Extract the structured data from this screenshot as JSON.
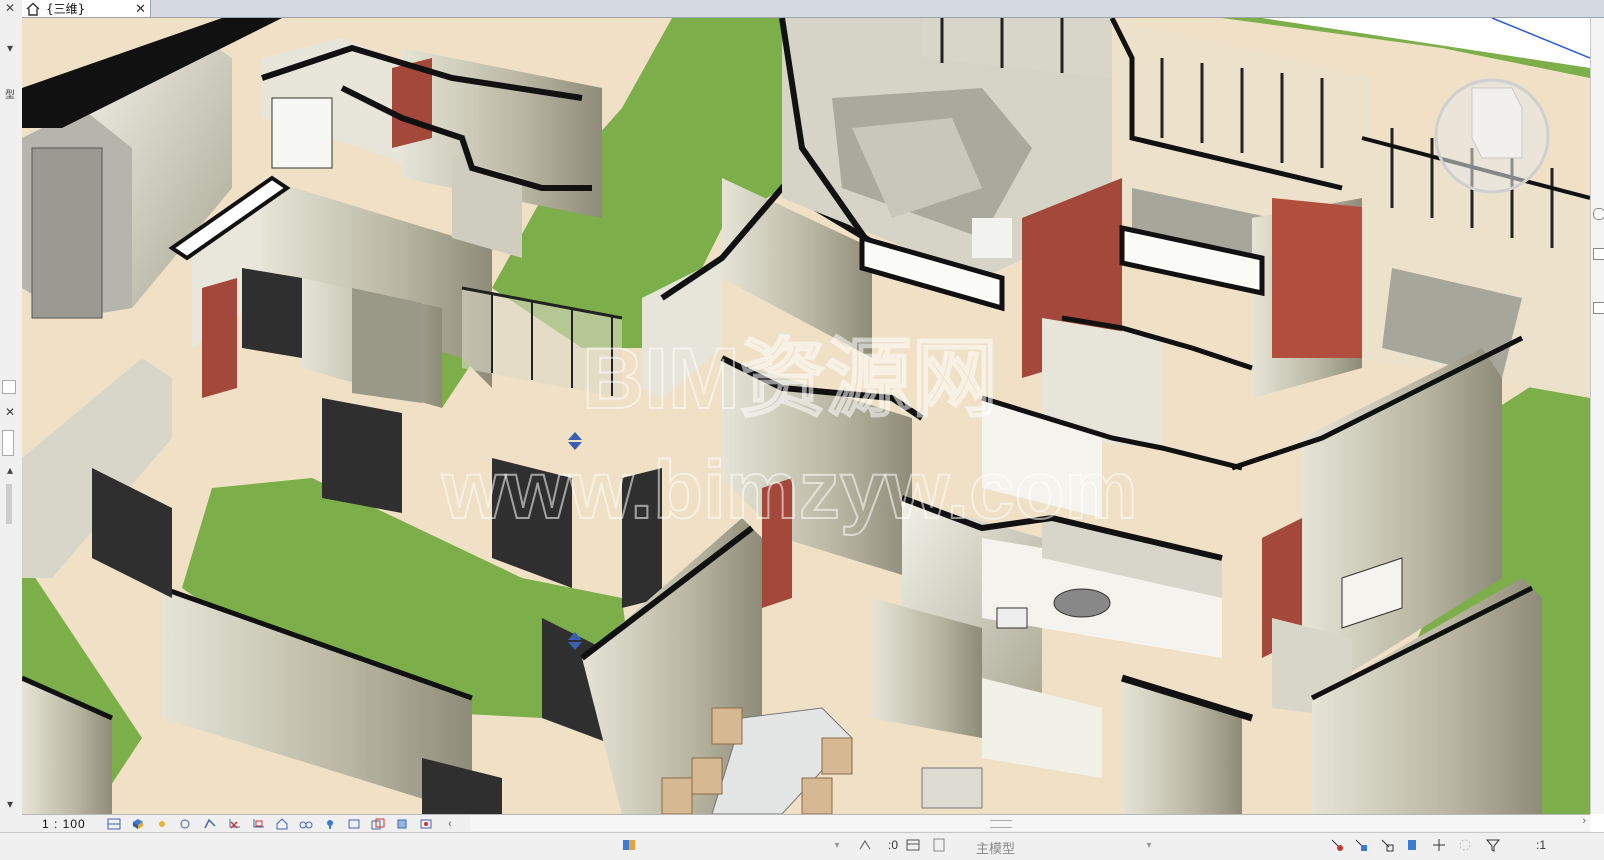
{
  "tab": {
    "title": "{三维}",
    "close": "✕"
  },
  "viewport": {
    "watermark_line1": "BIM资源网",
    "watermark_line2": "www.bimzyw.com"
  },
  "view_control_bar": {
    "scale": "1 : 100"
  },
  "status_bar": {
    "workset_count": ":0",
    "model_name": "主模型",
    "filter_count": ":1"
  },
  "colors": {
    "floor": "#efe0c6",
    "grass": "#7cae49",
    "wall_top": "#111111",
    "wall_face": "#c9c7b3",
    "accent_wall": "#a3483a",
    "door": "#3a3a3a"
  },
  "icons": [
    "home-icon",
    "close-icon",
    "scale-icon",
    "visual-style-icon",
    "sun-path-icon",
    "shadows-icon",
    "render-icon",
    "crop-icon",
    "crop-region-icon",
    "unlock-view-icon",
    "temporary-hide-icon",
    "reveal-hidden-icon",
    "analytical-model-icon",
    "highlight-displacement-icon",
    "constraints-icon",
    "view-cube-icon",
    "workset-icon",
    "design-option-icon",
    "model-icon",
    "link-select-icon",
    "underlay-select-icon",
    "pinned-select-icon",
    "face-select-icon",
    "drag-select-icon",
    "filter-icon"
  ]
}
